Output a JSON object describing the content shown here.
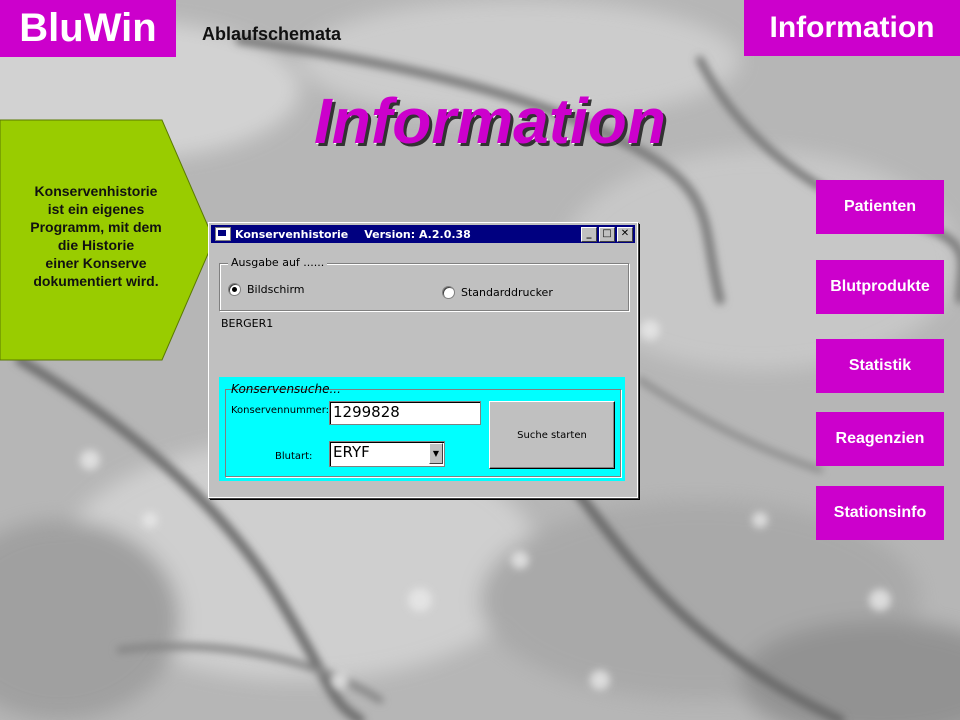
{
  "brand": "BluWin",
  "subtitle": "Ablaufschemata",
  "corner_label": "Information",
  "page_title": "Information",
  "callout_text": "Konservenhistorie\nist ein eigenes\nProgramm, mit dem\ndie Historie\neiner Konserve\ndokumentiert wird.",
  "nav": [
    "Patienten",
    "Blutprodukte",
    "Statistik",
    "Reagenzien",
    "Stationsinfo"
  ],
  "dialog": {
    "title": "Konservenhistorie",
    "version": "Version: A.2.0.38",
    "controls": {
      "minimize": "_",
      "maximize": "□",
      "close": "✕"
    },
    "output_group": "Ausgabe auf ......",
    "radio_screen": "Bildschirm",
    "radio_printer": "Standarddrucker",
    "user": "BERGER1",
    "search_group": "Konservensuche...",
    "unit_label": "Konservennummer:",
    "unit_value": "1299828",
    "type_label": "Blutart:",
    "type_value": "ERYF",
    "search_button": "Suche starten"
  },
  "colors": {
    "accent": "#cc00cc",
    "callout": "#99cc00",
    "search_panel": "#00ffff"
  }
}
